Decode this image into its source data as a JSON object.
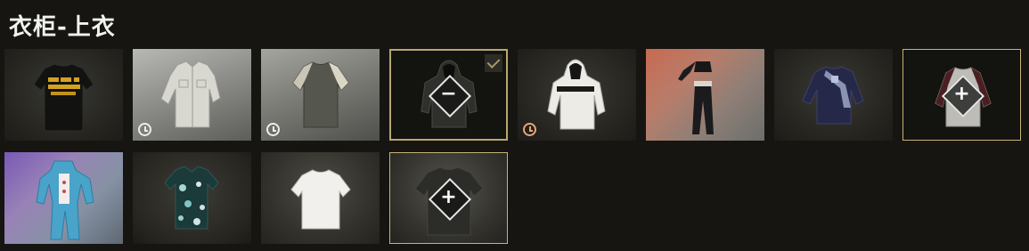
{
  "page": {
    "title": "衣柜-上衣"
  },
  "wardrobe": {
    "items": [
      {
        "name": "black-print-tshirt",
        "row": 0,
        "col": 0,
        "background": "dark",
        "has_timer": false
      },
      {
        "name": "white-button-shirt",
        "row": 0,
        "col": 1,
        "background": "silver",
        "has_timer": true,
        "timer_color": "#ececec"
      },
      {
        "name": "raglan-tshirt",
        "row": 0,
        "col": 2,
        "background": "grey",
        "has_timer": true,
        "timer_color": "#ececec"
      },
      {
        "name": "black-hoodie",
        "row": 0,
        "col": 3,
        "background": "black",
        "equipped": true,
        "action_icon": "minus",
        "checked": true
      },
      {
        "name": "white-hoodie",
        "row": 0,
        "col": 4,
        "background": "dark",
        "has_timer": true,
        "timer_color": "#e9a57a"
      },
      {
        "name": "crop-top-outfit",
        "row": 0,
        "col": 5,
        "background": "sunset"
      },
      {
        "name": "navy-sweater",
        "row": 0,
        "col": 6,
        "background": "dark"
      },
      {
        "name": "grey-raglan-shirt",
        "row": 0,
        "col": 7,
        "background": "black",
        "selected": true,
        "action_icon": "plus"
      },
      {
        "name": "blue-pajama-suit",
        "row": 1,
        "col": 0,
        "background": "purple"
      },
      {
        "name": "floral-shirt",
        "row": 1,
        "col": 1,
        "background": "dark"
      },
      {
        "name": "white-tshirt",
        "row": 1,
        "col": 2,
        "background": "dark"
      },
      {
        "name": "dark-tshirt",
        "row": 1,
        "col": 3,
        "background": "dark",
        "selected": true,
        "action_icon": "plus"
      }
    ],
    "symbols": {
      "plus": "+",
      "minus": "−"
    },
    "colors": {
      "selection_border": "#c8b377",
      "check_color": "#a39a6c"
    }
  }
}
